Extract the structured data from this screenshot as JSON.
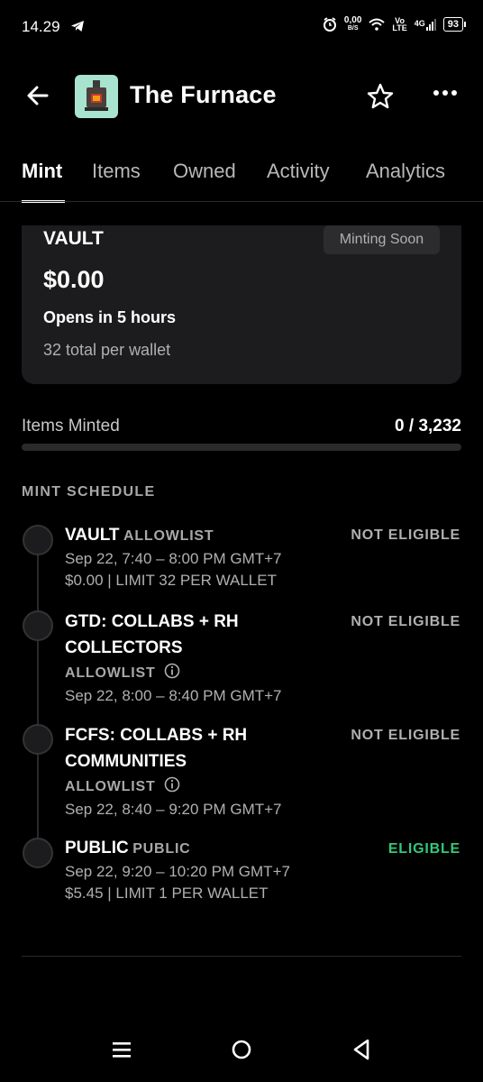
{
  "status_bar": {
    "time": "14.29",
    "net_speed": "0,00",
    "net_unit": "B/S",
    "volte_top": "Vo",
    "volte_bottom": "LTE",
    "network": "4G",
    "battery": "93"
  },
  "header": {
    "title": "The Furnace",
    "logo_color": "#a8e3cf"
  },
  "tabs": [
    {
      "label": "Mint",
      "active": true
    },
    {
      "label": "Items"
    },
    {
      "label": "Owned"
    },
    {
      "label": "Activity"
    },
    {
      "label": "Analytics"
    }
  ],
  "vault_card": {
    "name": "VAULT",
    "badge": "Minting Soon",
    "price": "$0.00",
    "opens": "Opens in 5 hours",
    "limit": "32 total per wallet"
  },
  "minted": {
    "label": "Items Minted",
    "value": "0 / 3,232",
    "progress_fraction": 0
  },
  "schedule": {
    "heading": "MINT SCHEDULE",
    "phases": [
      {
        "name": "VAULT",
        "type": "ALLOWLIST",
        "status": "NOT ELIGIBLE",
        "date": "Sep 22, 7:40 – 8:00 PM GMT+7",
        "details": "$0.00 | LIMIT 32 PER WALLET"
      },
      {
        "name_line1": "GTD: COLLABS + RH",
        "name_line2": "COLLECTORS",
        "type": "ALLOWLIST",
        "status": "NOT ELIGIBLE",
        "date": "Sep 22, 8:00 – 8:40 PM GMT+7"
      },
      {
        "name_line1": "FCFS: COLLABS + RH",
        "name_line2": "COMMUNITIES",
        "type": "ALLOWLIST",
        "status": "NOT ELIGIBLE",
        "date": "Sep 22, 8:40 – 9:20 PM GMT+7"
      },
      {
        "name": "PUBLIC",
        "type": "PUBLIC",
        "status": "ELIGIBLE",
        "date": "Sep 22, 9:20 – 10:20 PM GMT+7",
        "details": "$5.45 | LIMIT 1 PER WALLET"
      }
    ]
  },
  "colors": {
    "background": "#000000",
    "card": "#1c1c1e",
    "eligible": "#34c77b",
    "muted": "#b0b0b0"
  }
}
